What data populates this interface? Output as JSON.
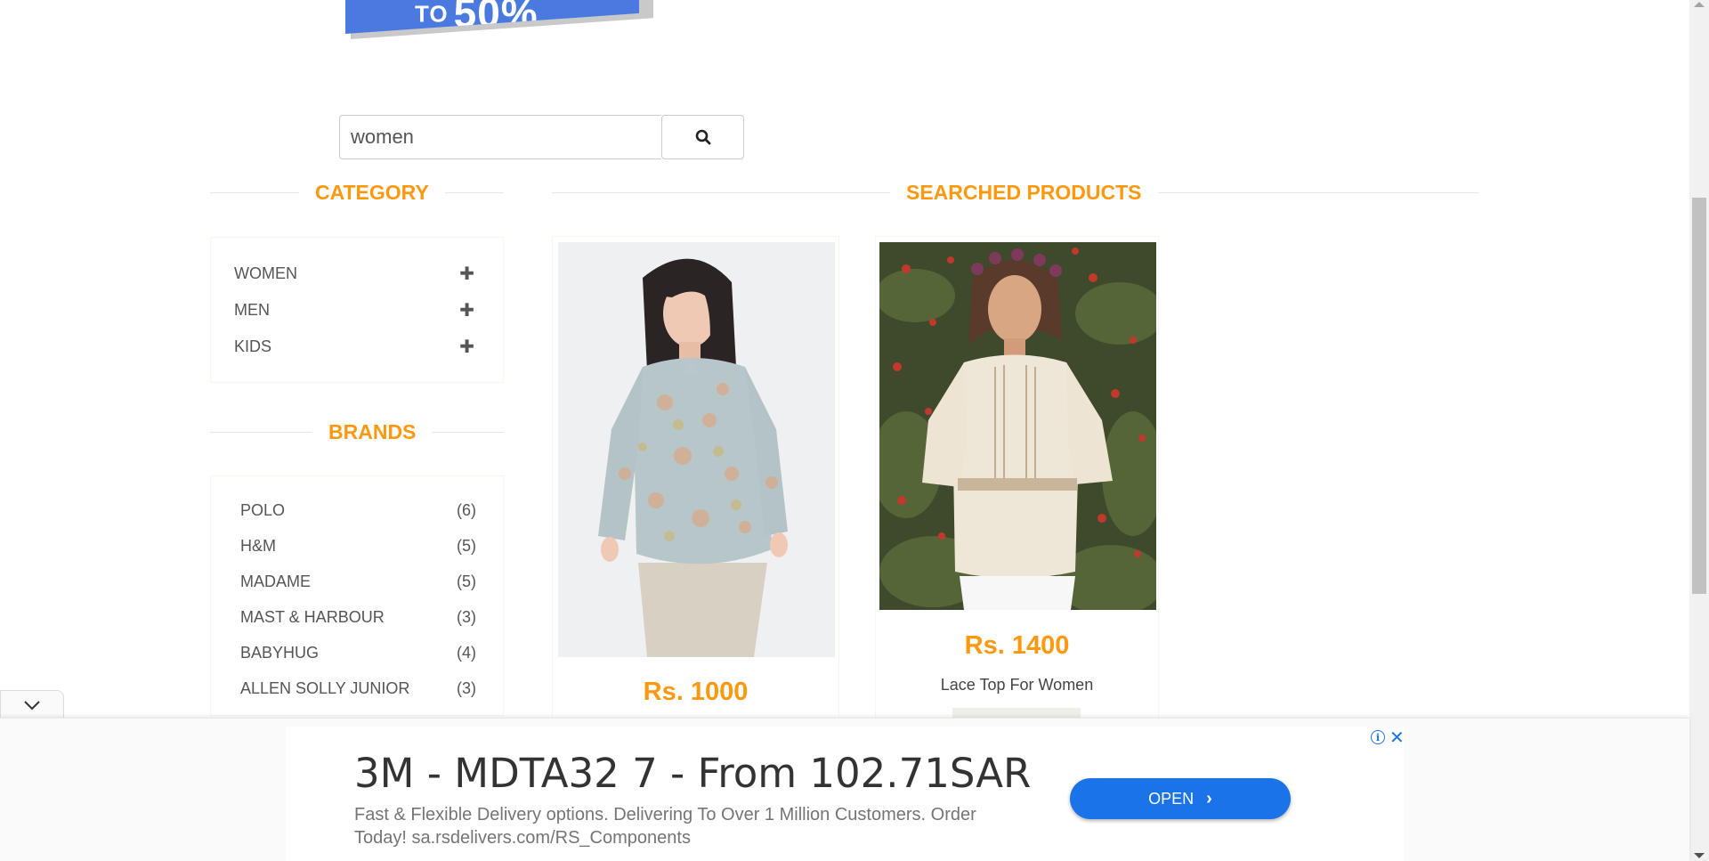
{
  "logo": {
    "text_small": "TO",
    "text_big": "50%"
  },
  "search": {
    "value": "women",
    "icon": "search-icon"
  },
  "category": {
    "title": "CATEGORY",
    "items": [
      {
        "label": "WOMEN"
      },
      {
        "label": "MEN"
      },
      {
        "label": "KIDS"
      }
    ]
  },
  "brands": {
    "title": "BRANDS",
    "items": [
      {
        "name": "POLO",
        "count": "(6)"
      },
      {
        "name": "H&M",
        "count": "(5)"
      },
      {
        "name": "MADAME",
        "count": "(5)"
      },
      {
        "name": "MAST & HARBOUR",
        "count": "(3)"
      },
      {
        "name": "BABYHUG",
        "count": "(4)"
      },
      {
        "name": "ALLEN SOLLY JUNIOR",
        "count": "(3)"
      }
    ]
  },
  "products": {
    "title": "SEARCHED PRODUCTS",
    "items": [
      {
        "price": "Rs. 1000",
        "name": ""
      },
      {
        "price": "Rs. 1400",
        "name": "Lace Top For Women"
      }
    ]
  },
  "ad": {
    "title": "3M - MDTA32 7 - From 102.71SAR",
    "description": "Fast & Flexible Delivery options. Delivering To Over 1 Million Customers. Order Today! sa.rsdelivers.com/RS_Components",
    "button": "OPEN",
    "accent": "#1a73e8"
  },
  "colors": {
    "accent_orange": "#fe980f",
    "logo_blue": "#4a7ae0"
  }
}
